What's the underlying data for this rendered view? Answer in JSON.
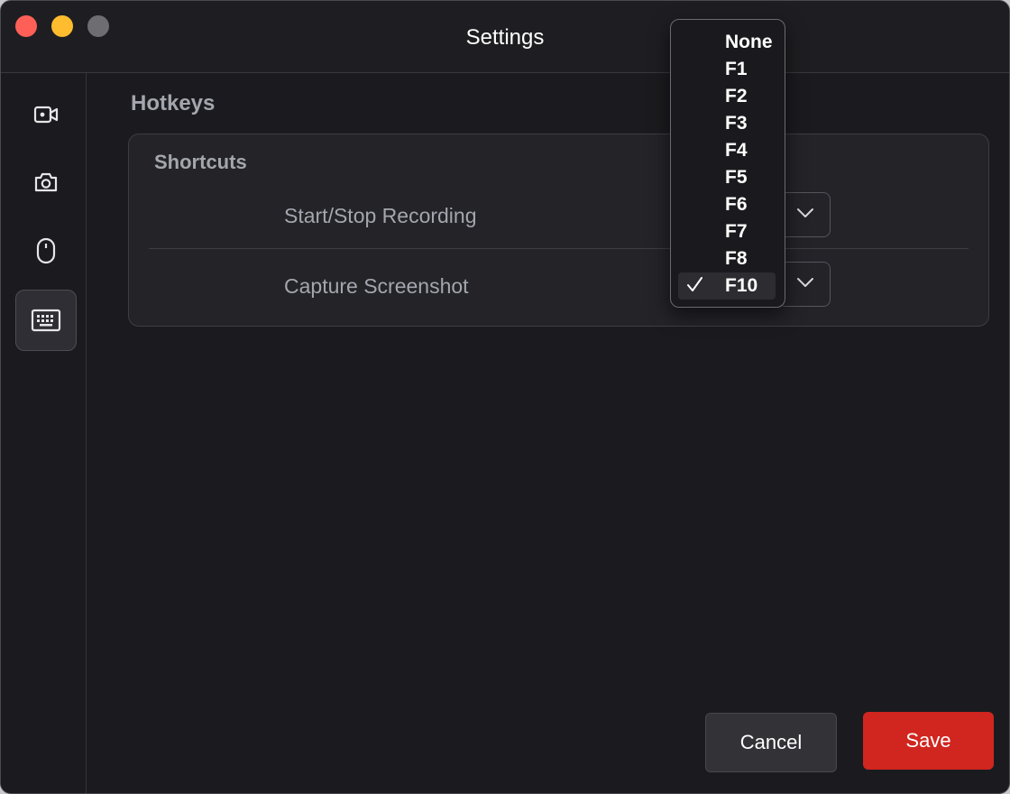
{
  "window": {
    "title": "Settings"
  },
  "sidebar": {
    "items": [
      {
        "name": "video-camera-icon",
        "active": false
      },
      {
        "name": "camera-icon",
        "active": false
      },
      {
        "name": "mouse-icon",
        "active": false
      },
      {
        "name": "keyboard-icon",
        "active": true
      }
    ]
  },
  "main": {
    "section_title": "Hotkeys",
    "card_title": "Shortcuts",
    "rows": [
      {
        "label": "Start/Stop Recording"
      },
      {
        "label": "Capture Screenshot"
      }
    ]
  },
  "dropdown": {
    "options": [
      "None",
      "F1",
      "F2",
      "F3",
      "F4",
      "F5",
      "F6",
      "F7",
      "F8",
      "F10"
    ],
    "selected": "F10"
  },
  "footer": {
    "cancel_label": "Cancel",
    "save_label": "Save"
  },
  "colors": {
    "accent": "#d0261f",
    "background": "#1b1b1f",
    "traffic_close": "#fe5f57",
    "traffic_minimize": "#febc2e",
    "traffic_zoom": "#6e6e72"
  }
}
